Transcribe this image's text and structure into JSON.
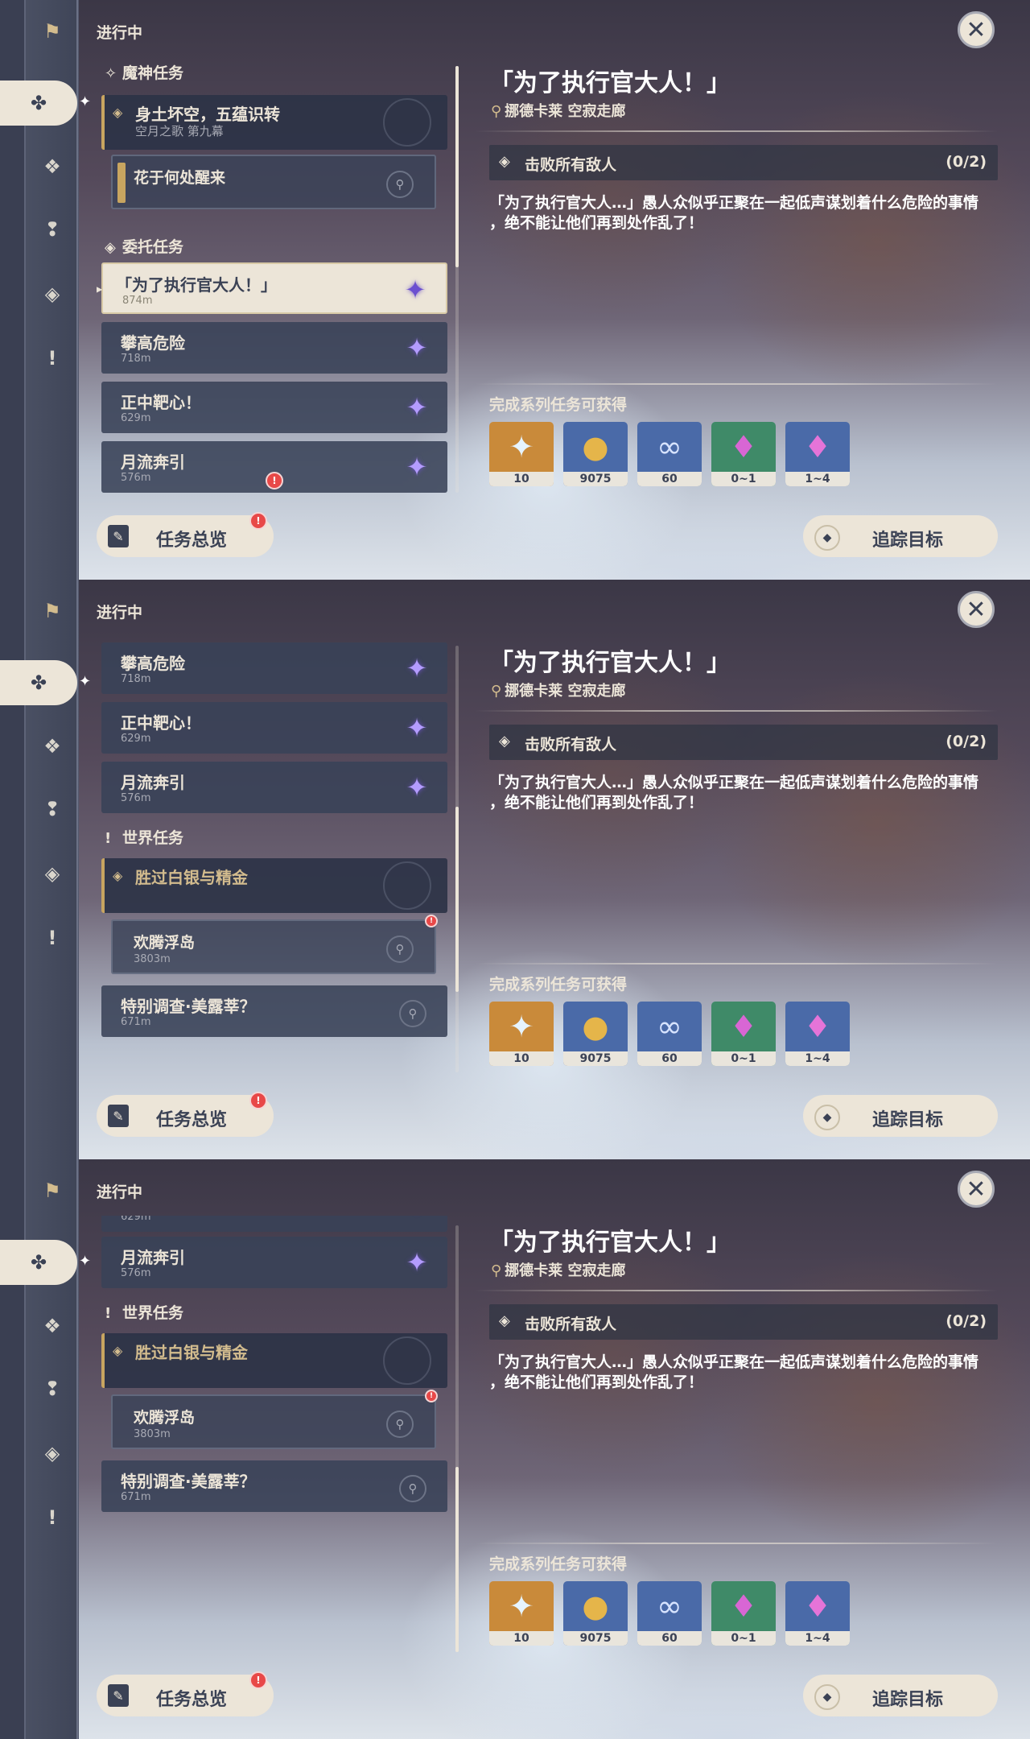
{
  "status_label": "进行中",
  "close_icon": "✕",
  "overview_button": {
    "label": "任务总览",
    "alert": "!"
  },
  "track_button": {
    "label": "追踪目标"
  },
  "detail": {
    "title": "「为了执行官大人！」",
    "location": "挪德卡莱 空寂走廊",
    "objective": "击败所有敌人",
    "progress": "(0/2)",
    "description_line1": "「为了执行官大人…」愚人众似乎正聚在一起低声谋划着什么危险的事情",
    "description_line2": "，绝不能让他们再到处作乱了！",
    "rewards_label": "完成系列任务可获得",
    "rewards": [
      {
        "icon": "primogem-icon",
        "count": "10",
        "color": "#c98a3a"
      },
      {
        "icon": "mora-icon",
        "count": "9075",
        "color": "#4a6aa8"
      },
      {
        "icon": "companionship-exp-icon",
        "count": "60",
        "color": "#4a6aa8"
      },
      {
        "icon": "crystal-chunk-icon",
        "count": "0~1",
        "color": "#3f8a68"
      },
      {
        "icon": "crystal-cluster-icon",
        "count": "1~4",
        "color": "#4a6aa8"
      }
    ]
  },
  "categories": {
    "archon": "魔神任务",
    "commission": "委托任务",
    "world": "世界任务"
  },
  "quests": {
    "archon_main": {
      "title": "身土坏空，五蕴识转",
      "sub": "空月之歌 第九幕"
    },
    "archon_sub": {
      "title": "花于何处醒来"
    },
    "c1": {
      "title": "「为了执行官大人！」",
      "dist": "874m"
    },
    "c2": {
      "title": "攀高危险",
      "dist": "718m"
    },
    "c3": {
      "title": "正中靶心！",
      "dist": "629m"
    },
    "c4": {
      "title": "月流奔引",
      "dist": "576m"
    },
    "world_main": {
      "title": "胜过白银与精金"
    },
    "world_sub": {
      "title": "欢腾浮岛",
      "dist": "3803m"
    },
    "world2": {
      "title": "特别调查·美露莘？",
      "dist": "671m"
    }
  }
}
